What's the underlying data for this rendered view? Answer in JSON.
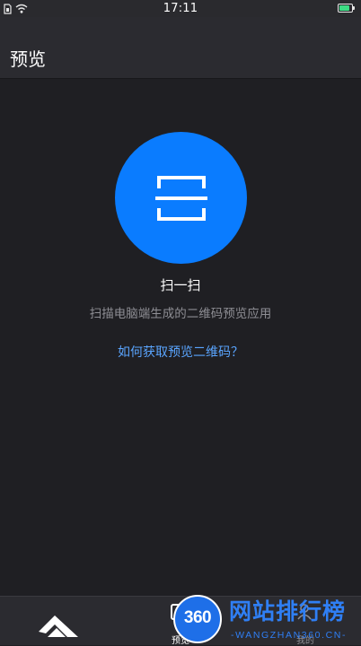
{
  "status_bar": {
    "time": "17:11",
    "battery_percent": 85,
    "battery_color": "#3ddc84"
  },
  "header": {
    "title": "预览"
  },
  "scan": {
    "title": "扫一扫",
    "subtitle": "扫描电脑端生成的二维码预览应用",
    "help_link": "如何获取预览二维码？",
    "button_color": "#0a7cff",
    "link_color": "#5aa5ff"
  },
  "bottom_nav": {
    "items": [
      {
        "label": "",
        "icon": "app-logo-icon"
      },
      {
        "label": "预览",
        "icon": "preview-icon"
      },
      {
        "label": "我的",
        "icon": "profile-icon"
      }
    ]
  },
  "watermark": {
    "badge": "360",
    "name": "网站排行榜",
    "domain": "-WANGZHAN360.CN-"
  }
}
